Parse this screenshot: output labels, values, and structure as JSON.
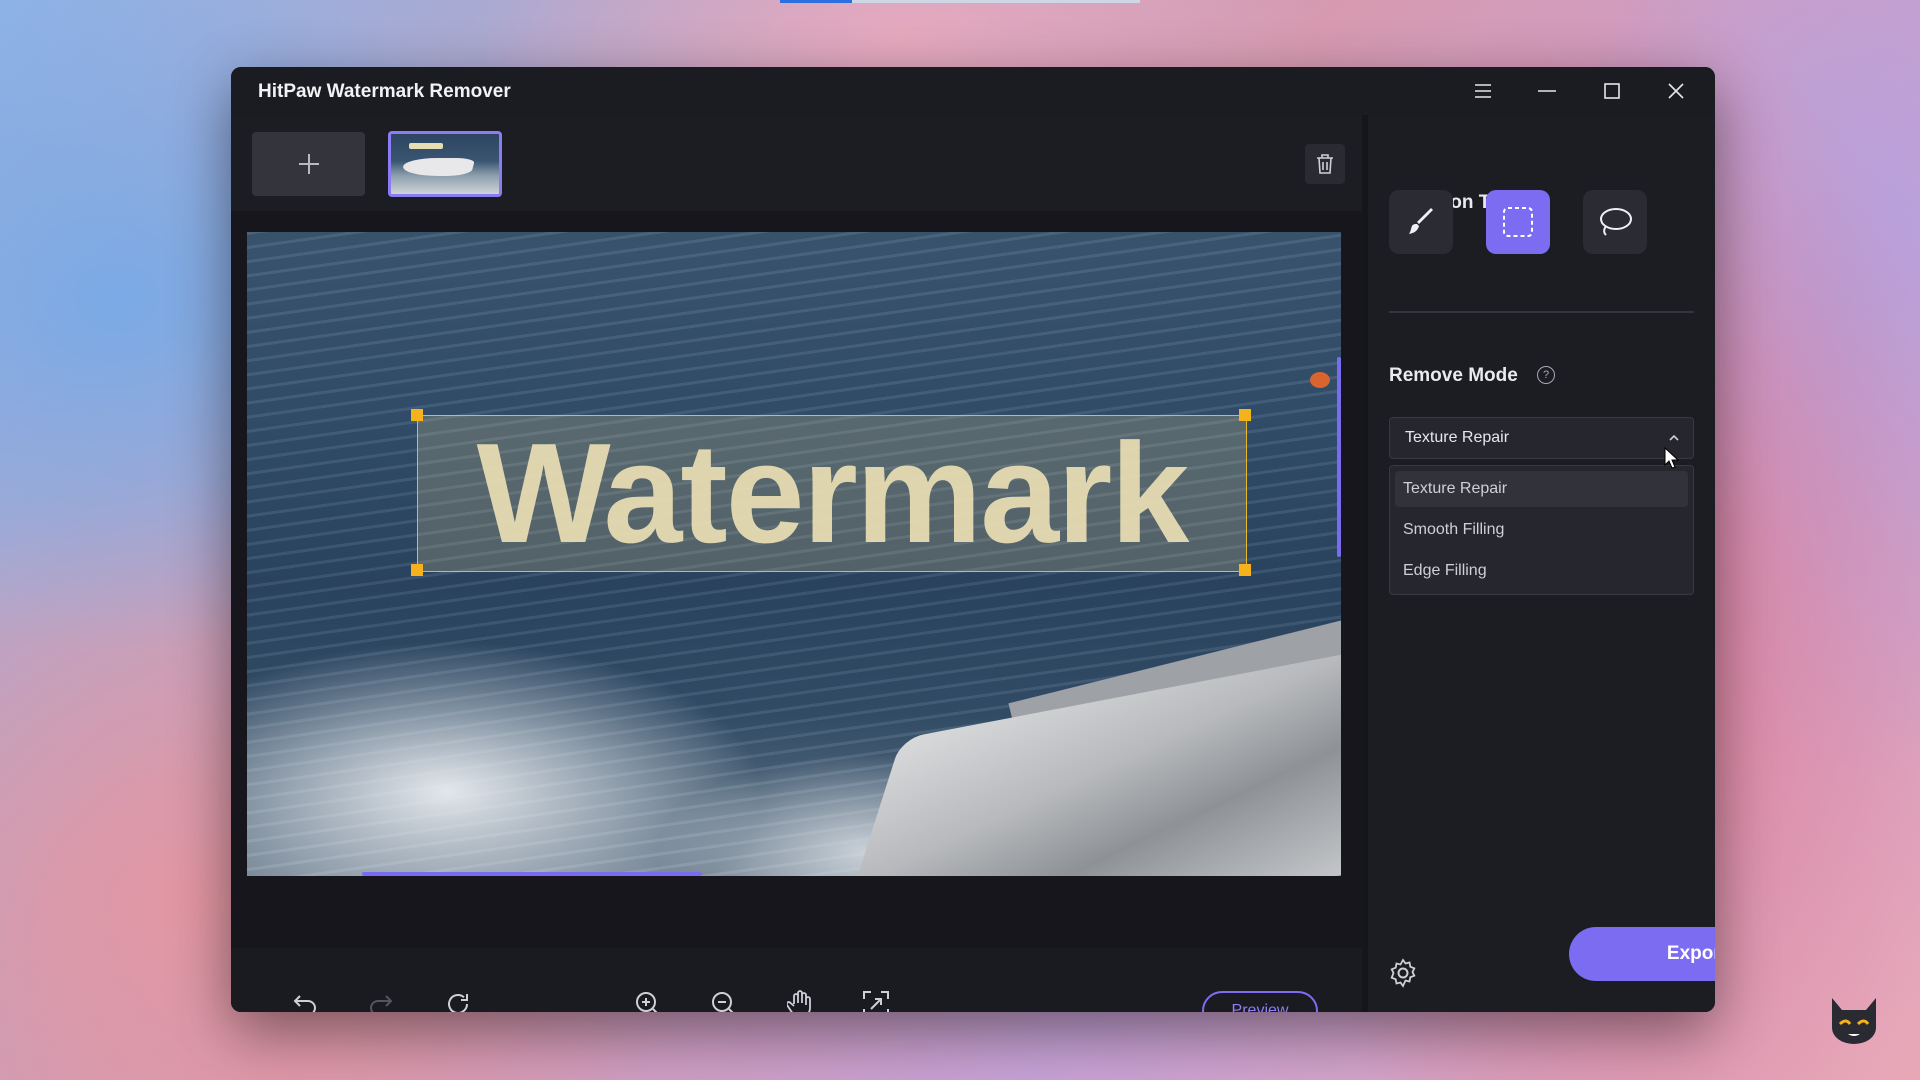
{
  "app": {
    "title": "HitPaw Watermark Remover"
  },
  "canvas": {
    "watermark_text": "Watermark"
  },
  "right_panel": {
    "selection_tool_title": "Selection Tool",
    "remove_mode_title": "Remove Mode",
    "remove_mode_selected": "Texture Repair",
    "remove_mode_options": [
      "Texture Repair",
      "Smooth Filling",
      "Edge Filling"
    ],
    "export_label": "Export"
  },
  "bottom_bar": {
    "preview_label": "Preview"
  },
  "colors": {
    "accent": "#7c6cf2",
    "handle": "#f6b21b",
    "background": "#15151b"
  },
  "icons": [
    "menu-icon",
    "minimize-icon",
    "maximize-icon",
    "close-icon",
    "plus-icon",
    "trash-icon",
    "brush-icon",
    "rectangle-select-icon",
    "lasso-icon",
    "help-icon",
    "chevron-up-icon",
    "undo-icon",
    "redo-icon",
    "reset-icon",
    "zoom-in-icon",
    "zoom-out-icon",
    "hand-icon",
    "fit-screen-icon",
    "gear-icon"
  ]
}
